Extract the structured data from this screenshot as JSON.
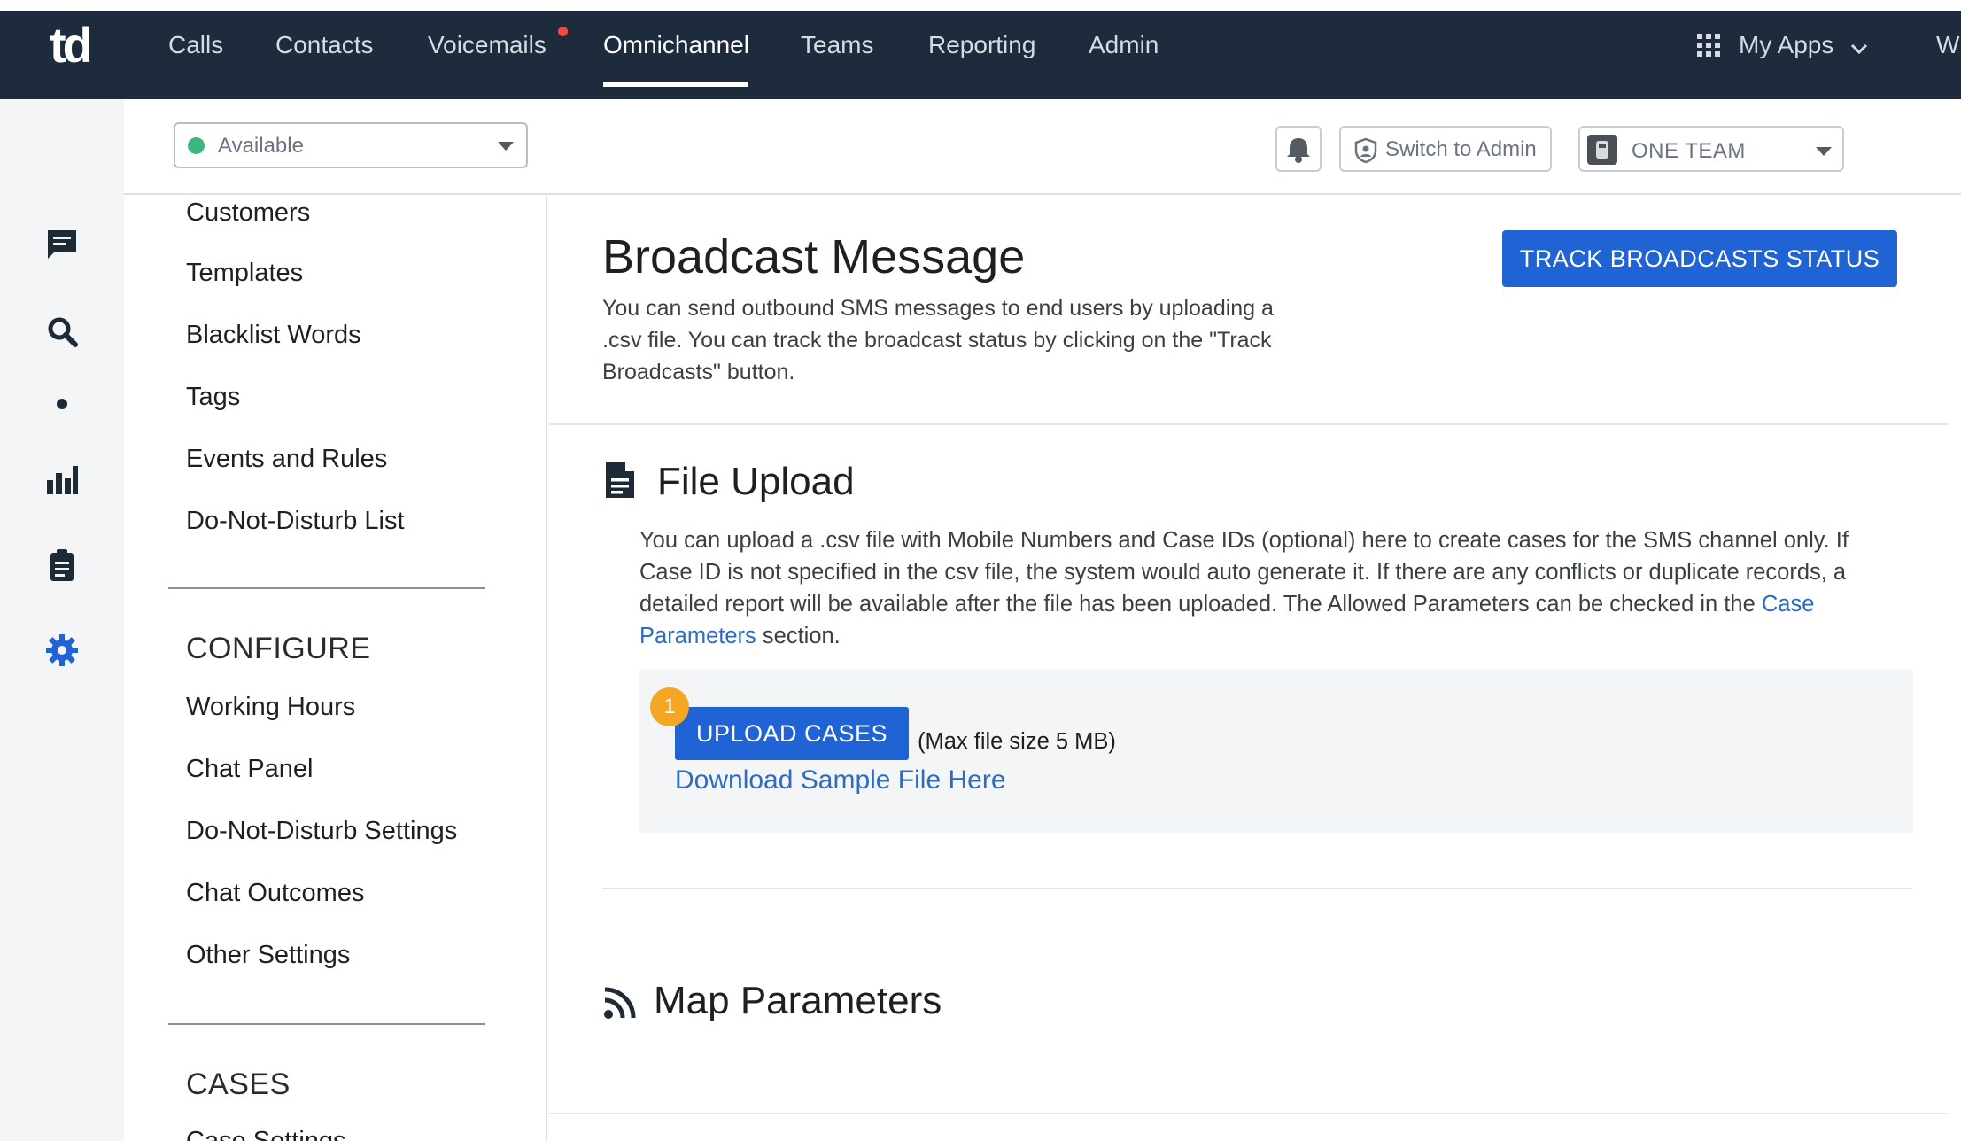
{
  "topnav": {
    "logo": "td",
    "items": [
      "Calls",
      "Contacts",
      "Voicemails",
      "Omnichannel",
      "Teams",
      "Reporting",
      "Admin"
    ],
    "active": "Omnichannel",
    "my_apps": "My Apps",
    "truncated": "W"
  },
  "rail": {
    "icons": [
      "chat-icon",
      "search-icon",
      "dot-icon",
      "bar-chart-icon",
      "clipboard-icon",
      "settings-gear-icon"
    ],
    "active_color": "#1f63d4"
  },
  "subbar": {
    "status": "Available",
    "status_color": "#3bb77e",
    "switch_label": "Switch to Admin",
    "team": "ONE TEAM"
  },
  "sidemenu": {
    "items_a": [
      "Customers",
      "Templates",
      "Blacklist Words",
      "Tags",
      "Events and Rules",
      "Do-Not-Disturb List"
    ],
    "configure_head": "CONFIGURE",
    "items_b": [
      "Working Hours",
      "Chat Panel",
      "Do-Not-Disturb Settings",
      "Chat Outcomes",
      "Other Settings"
    ],
    "cases_head": "CASES",
    "items_c": [
      "Case Settings"
    ]
  },
  "main": {
    "title": "Broadcast Message",
    "description": "You can send outbound SMS messages to end users by uploading a .csv file. You can track the broadcast status by clicking on the \"Track Broadcasts\" button.",
    "track_button": "TRACK BROADCASTS STATUS",
    "file_upload": {
      "title": "File Upload",
      "desc_before_link": "You can upload a .csv file with Mobile Numbers and Case IDs (optional) here to create cases for the SMS channel only. If Case ID is not specified in the csv file, the system would auto generate it. If there are any conflicts or duplicate records, a detailed report will be available after the file has been uploaded. The Allowed Parameters can be checked in the ",
      "desc_link": "Case Parameters",
      "desc_after_link": " section.",
      "step_badge": "1",
      "upload_button": "UPLOAD CASES",
      "max_size": "(Max file size 5 MB)",
      "sample_link": "Download Sample File Here"
    },
    "map_parameters": {
      "title": "Map Parameters"
    }
  },
  "colors": {
    "nav_bg": "#1d2b3c",
    "primary": "#1f63d4",
    "link": "#2d6cc0",
    "badge": "#f5a623",
    "notification_dot": "#ef4b3f"
  }
}
